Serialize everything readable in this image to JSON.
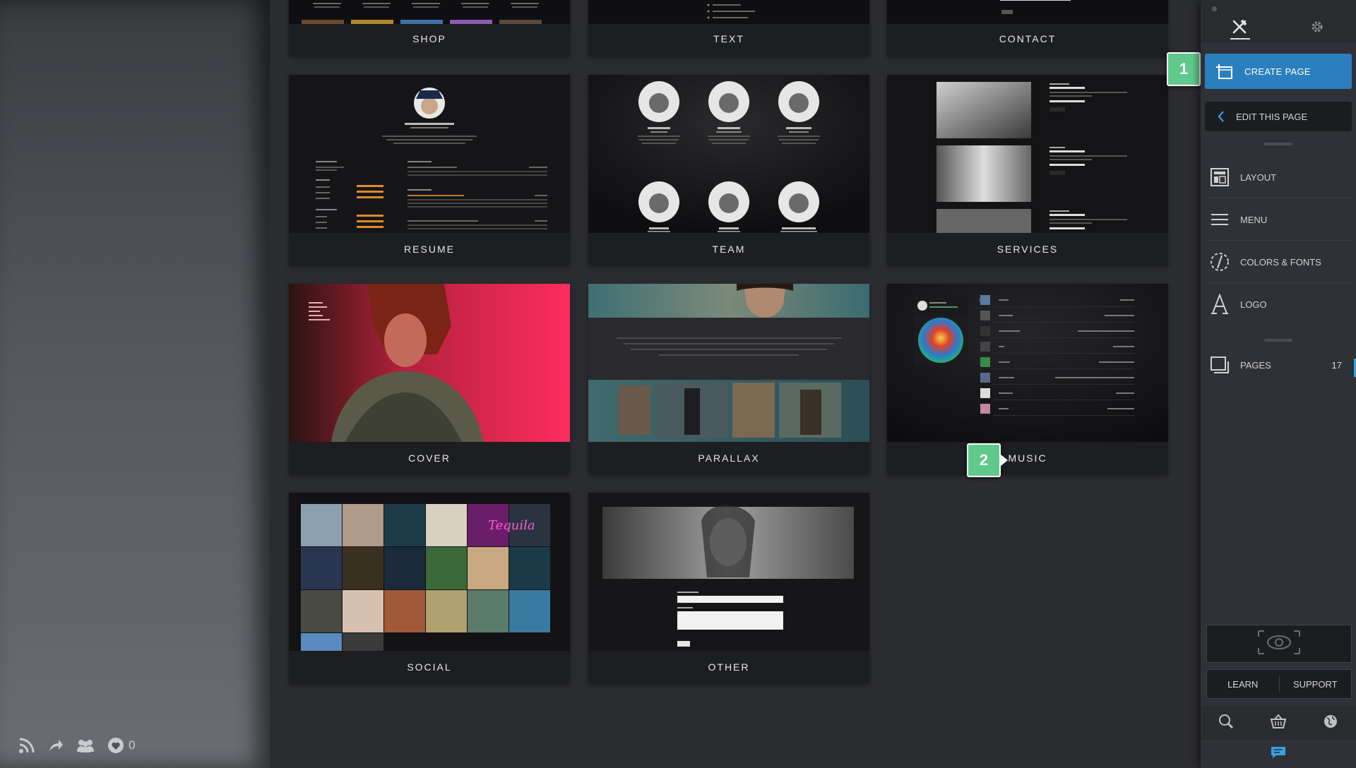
{
  "cards": {
    "shop": "SHOP",
    "text": "TEXT",
    "contact": "CONTACT",
    "resume": "RESUME",
    "team": "TEAM",
    "services": "SERVICES",
    "cover": "COVER",
    "parallax": "PARALLAX",
    "music": "MUSIC",
    "social": "SOCIAL",
    "other": "OTHER"
  },
  "callouts": {
    "one": "1",
    "two": "2"
  },
  "sidebar": {
    "create_page": "CREATE PAGE",
    "edit_this_page": "EDIT THIS PAGE",
    "layout": "LAYOUT",
    "menu": "MENU",
    "colors_fonts": "COLORS & FONTS",
    "logo": "LOGO",
    "pages": "PAGES",
    "pages_count": "17",
    "learn": "LEARN",
    "support": "SUPPORT"
  },
  "footer": {
    "likes": "0"
  },
  "icons": [
    "rss-icon",
    "share-icon",
    "people-icon",
    "heart-icon",
    "tools-icon",
    "gear-icon",
    "create-page-icon",
    "chevron-left-icon",
    "layout-icon",
    "menu-lines-icon",
    "colors-fonts-icon",
    "logo-icon",
    "pages-icon",
    "eye-icon",
    "search-icon",
    "basket-icon",
    "globe-icon",
    "chat-icon"
  ],
  "colors": {
    "accent": "#2b7fbe",
    "callout": "#5fc98b",
    "background": "#2b2c30",
    "sidebar": "#303136"
  }
}
